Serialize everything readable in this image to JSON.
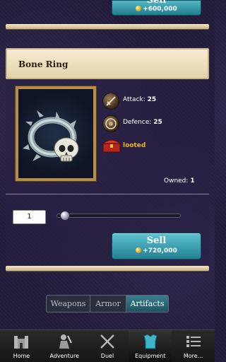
{
  "top_card": {
    "sell_label": "Sell",
    "sell_price": "+600,000"
  },
  "item": {
    "name": "Bone Ring",
    "attack_label": "Attack:",
    "attack_value": "25",
    "defence_label": "Defence:",
    "defence_value": "25",
    "source": "looted",
    "owned_label": "Owned:",
    "owned_value": "1",
    "quantity": "1",
    "slider_fraction": 0.03,
    "sell_label": "Sell",
    "sell_price": "+720,000"
  },
  "tabs": [
    {
      "label": "Weapons",
      "active": false
    },
    {
      "label": "Armor",
      "active": false
    },
    {
      "label": "Artifacts",
      "active": true
    }
  ],
  "nav": [
    {
      "label": "Home",
      "icon": "castle-icon",
      "active": false
    },
    {
      "label": "Adventure",
      "icon": "knight-icon",
      "active": false
    },
    {
      "label": "Duel",
      "icon": "crossed-swords-icon",
      "active": false
    },
    {
      "label": "Equipment",
      "icon": "armor-icon",
      "active": true
    },
    {
      "label": "More...",
      "icon": "list-icon",
      "active": false
    }
  ],
  "colors": {
    "sell_button": "#238093",
    "accent_tab": "#1f5360",
    "looted": "#f0b429"
  }
}
